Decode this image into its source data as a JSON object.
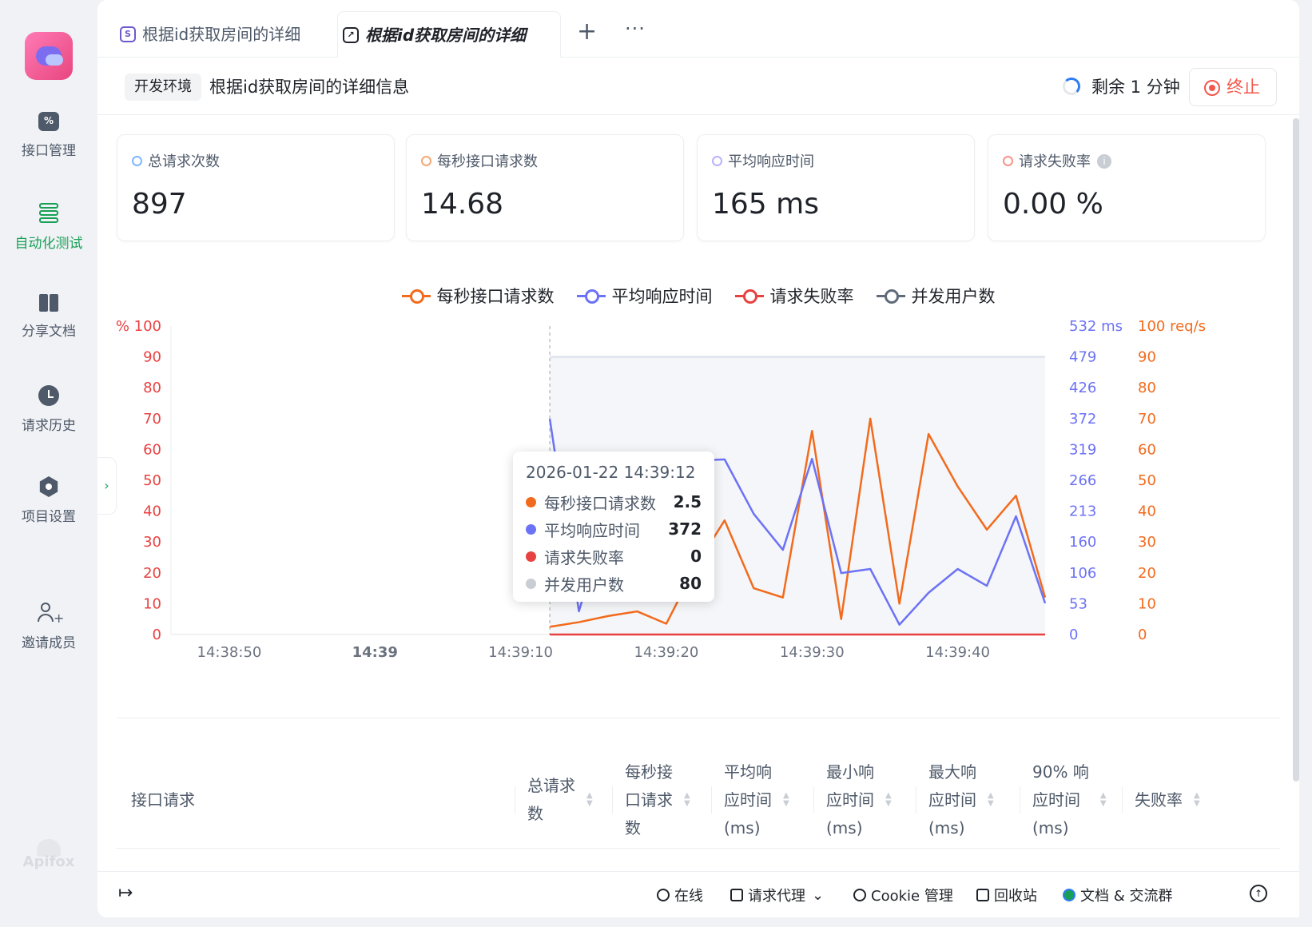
{
  "sidebar": {
    "items": [
      {
        "label": "接口管理",
        "icon": "api-management-icon",
        "active": false
      },
      {
        "label": "自动化测试",
        "icon": "automation-test-icon",
        "active": true
      },
      {
        "label": "分享文档",
        "icon": "share-docs-icon",
        "active": false
      },
      {
        "label": "请求历史",
        "icon": "history-clock-icon",
        "active": false
      },
      {
        "label": "项目设置",
        "icon": "settings-icon",
        "active": false
      },
      {
        "label": "邀请成员",
        "icon": "invite-member-icon",
        "active": false
      }
    ],
    "brand": "Apifox"
  },
  "tabs": [
    {
      "label": "根据id获取房间的详细",
      "icon": "s-badge-icon",
      "active": false
    },
    {
      "label": "根据id获取房间的详细",
      "icon": "performance-chart-icon",
      "active": true
    }
  ],
  "tab_controls": {
    "add": "+",
    "more": "···"
  },
  "header": {
    "env": "开发环境",
    "title": "根据id获取房间的详细信息",
    "remaining": "剩余 1 分钟",
    "stop_label": "终止"
  },
  "stats": [
    {
      "label": "总请求次数",
      "value": "897",
      "color": "#7fb6ff"
    },
    {
      "label": "每秒接口请求数",
      "value": "14.68",
      "color": "#f7a773"
    },
    {
      "label": "平均响应时间",
      "value": "165 ms",
      "color": "#b9b2ff"
    },
    {
      "label": "请求失败率",
      "value": "0.00 %",
      "color": "#f7938a",
      "info": "i"
    }
  ],
  "chart_data": {
    "type": "line",
    "legend": [
      {
        "name": "每秒接口请求数",
        "color": "#f26b1d"
      },
      {
        "name": "平均响应时间",
        "color": "#6c72f5"
      },
      {
        "name": "请求失败率",
        "color": "#e84141"
      },
      {
        "name": "并发用户数",
        "color": "#5f6b7a"
      }
    ],
    "x_ticks": [
      "14:38:50",
      "14:39",
      "14:39:10",
      "14:39:20",
      "14:39:30",
      "14:39:40"
    ],
    "x_range": [
      "14:38:46",
      "14:39:46"
    ],
    "y_left": {
      "unit_label": "%",
      "ticks": [
        0,
        10,
        20,
        30,
        40,
        50,
        60,
        70,
        80,
        90,
        100
      ],
      "color": "#e84141"
    },
    "y_mid": {
      "unit_label": "ms",
      "ticks": [
        0,
        53,
        106,
        160,
        213,
        266,
        319,
        372,
        426,
        479,
        532
      ],
      "color": "#6c72f5"
    },
    "y_right": {
      "unit_label": "req/s",
      "ticks": [
        0,
        10,
        20,
        30,
        40,
        50,
        60,
        70,
        80,
        90,
        100
      ],
      "color": "#f26b1d"
    },
    "series": [
      {
        "name": "每秒接口请求数",
        "axis": "right",
        "x": [
          "14:39:12",
          "14:39:14",
          "14:39:16",
          "14:39:18",
          "14:39:20",
          "14:39:22",
          "14:39:24",
          "14:39:26",
          "14:39:28",
          "14:39:30",
          "14:39:32",
          "14:39:34",
          "14:39:36",
          "14:39:38",
          "14:39:40",
          "14:39:42",
          "14:39:44",
          "14:39:46"
        ],
        "values": [
          2.5,
          4,
          6,
          7.5,
          3.5,
          22,
          37,
          15,
          12,
          66,
          5,
          70,
          10,
          65,
          48,
          34,
          45,
          12
        ]
      },
      {
        "name": "平均响应时间",
        "axis": "mid",
        "x": [
          "14:39:12",
          "14:39:14",
          "14:39:16",
          "14:39:18",
          "14:39:20",
          "14:39:22",
          "14:39:24",
          "14:39:26",
          "14:39:28",
          "14:39:30",
          "14:39:32",
          "14:39:34",
          "14:39:36",
          "14:39:38",
          "14:39:40",
          "14:39:42",
          "14:39:44",
          "14:39:46"
        ],
        "values": [
          372,
          40,
          210,
          250,
          230,
          300,
          302,
          208,
          146,
          303,
          106,
          113,
          17,
          72,
          113,
          84,
          204,
          54
        ]
      },
      {
        "name": "请求失败率",
        "axis": "left",
        "x": [
          "14:39:12",
          "14:39:46"
        ],
        "values": [
          0,
          0
        ]
      },
      {
        "name": "并发用户数",
        "axis": "left",
        "x": [
          "14:39:12",
          "14:39:46"
        ],
        "values": [
          90,
          90
        ],
        "area": true
      }
    ],
    "tooltip": {
      "time": "2026-01-22 14:39:12",
      "rows": [
        {
          "name": "每秒接口请求数",
          "value": "2.5",
          "color": "#f26b1d"
        },
        {
          "name": "平均响应时间",
          "value": "372",
          "color": "#6c72f5"
        },
        {
          "name": "请求失败率",
          "value": "0",
          "color": "#e84141"
        },
        {
          "name": "并发用户数",
          "value": "80",
          "color": "#c9cdd4"
        }
      ]
    }
  },
  "table": {
    "columns": [
      "接口请求",
      "总请求\n数",
      "每秒接\n口请求\n数",
      "平均响\n应时间\n(ms)",
      "最小响\n应时间\n(ms)",
      "最大响\n应时间\n(ms)",
      "90% 响\n应时间\n(ms)",
      "失败率"
    ]
  },
  "footer": {
    "items": [
      {
        "label": "在线",
        "icon": "online-check-icon"
      },
      {
        "label": "请求代理",
        "icon": "proxy-icon",
        "dropdown": "⌄"
      },
      {
        "label": "Cookie 管理",
        "icon": "cookie-icon"
      },
      {
        "label": "回收站",
        "icon": "trash-icon"
      },
      {
        "label": "文档 & 交流群",
        "icon": "chat-icon"
      }
    ]
  }
}
